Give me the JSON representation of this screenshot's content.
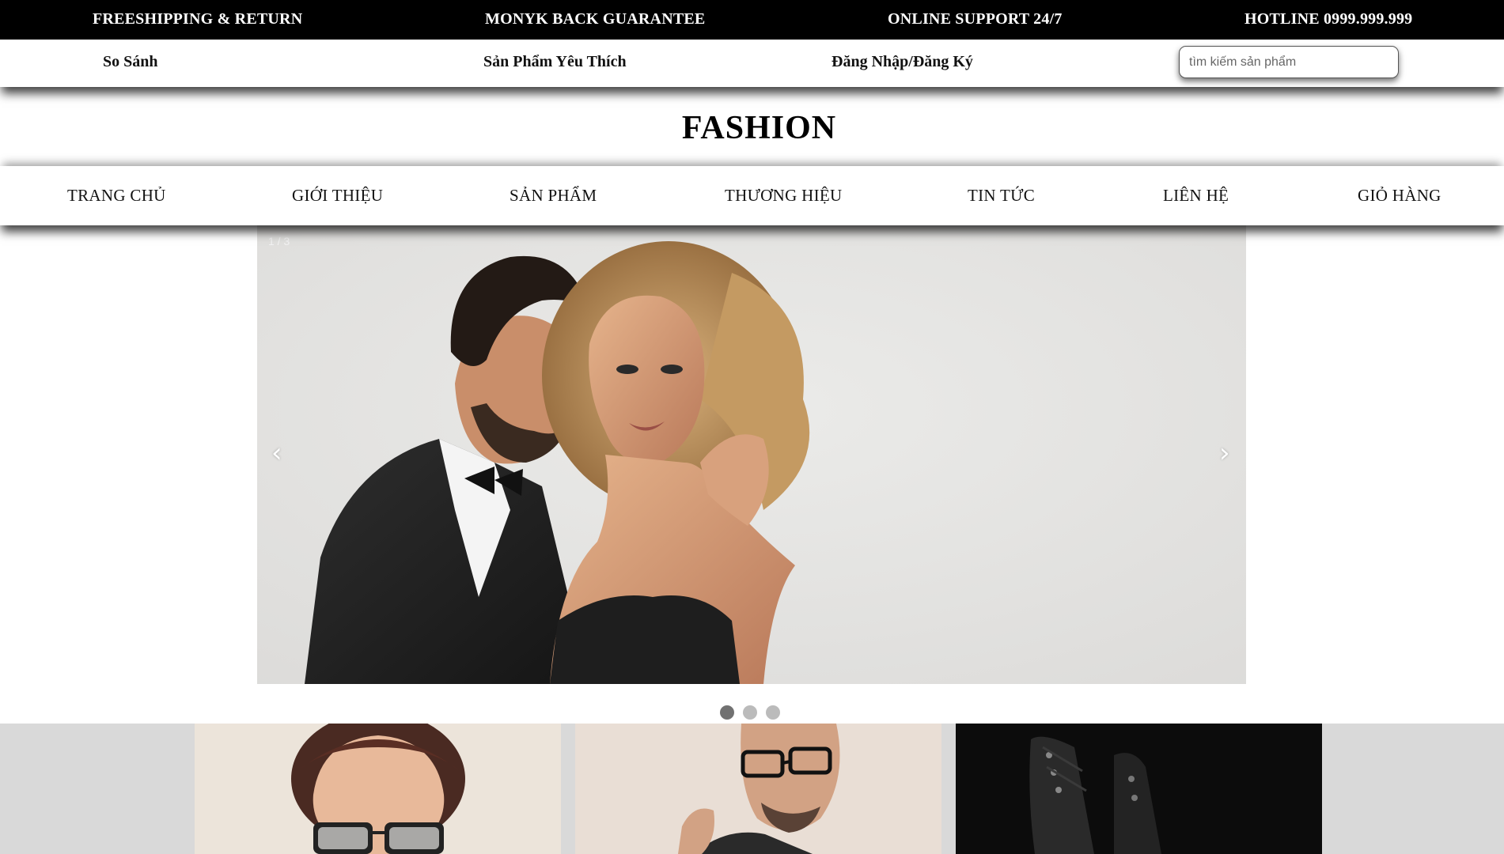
{
  "topbar": {
    "items": [
      "FREESHIPPING & RETURN",
      "MONYK BACK GUARANTEE",
      "ONLINE SUPPORT 24/7",
      "HOTLINE 0999.999.999"
    ]
  },
  "utilbar": {
    "compare": "So Sánh",
    "favorites": "Sản Phẩm Yêu Thích",
    "login": "Đăng Nhập/Đăng Ký",
    "search_placeholder": "tìm kiếm sản phẩm"
  },
  "logo": "FASHION",
  "nav": {
    "items": [
      "TRANG CHỦ",
      "GIỚI THIỆU",
      "SẢN PHẨM",
      "THƯƠNG HIỆU",
      "TIN TỨC",
      "LIÊN HỆ",
      "GIỎ HÀNG"
    ]
  },
  "slider": {
    "counter": "1 / 3",
    "prev": "‹",
    "next": "›",
    "dots_count": 3,
    "active_dot": 1
  },
  "products": [
    "woman-sunglasses",
    "man-glasses",
    "black-boots"
  ],
  "colors": {
    "topbar_bg": "#000000",
    "products_bg": "#d9d9d9",
    "dot_active": "#717171",
    "dot_inactive": "#bbbbbb"
  }
}
